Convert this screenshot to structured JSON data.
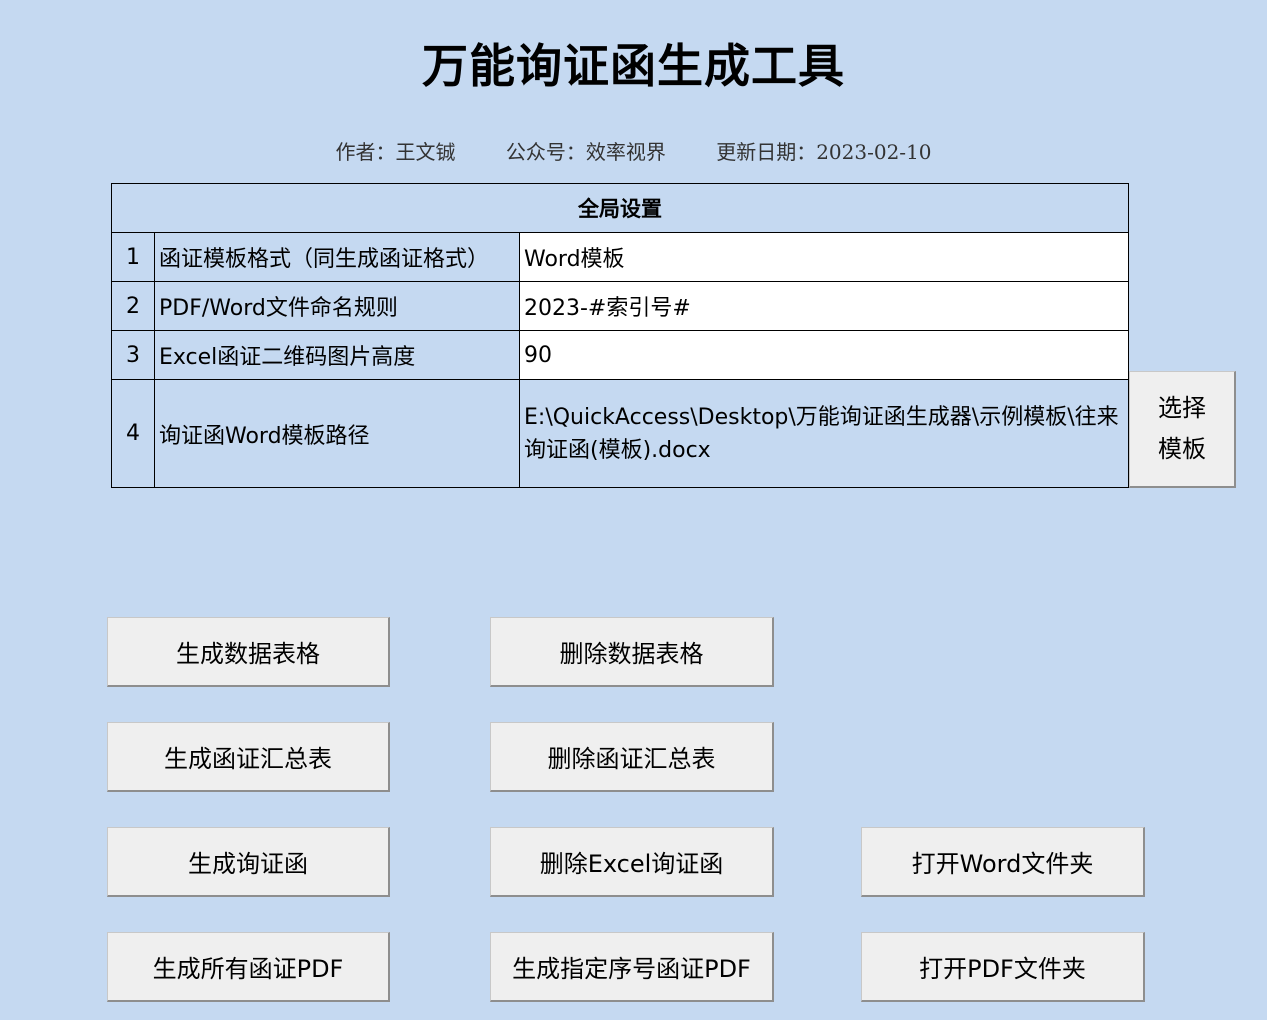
{
  "title": "万能询证函生成工具",
  "author": "作者：王文铖",
  "wechat": "公众号：效率视界",
  "update": "更新日期：2023-02-10",
  "settings": {
    "header": "全局设置",
    "rows": [
      {
        "num": "1",
        "label": "函证模板格式（同生成函证格式）",
        "value": "Word模板"
      },
      {
        "num": "2",
        "label": "PDF/Word文件命名规则",
        "value": "2023-#索引号#"
      },
      {
        "num": "3",
        "label": "Excel函证二维码图片高度",
        "value": "90"
      },
      {
        "num": "4",
        "label": "询证函Word模板路径",
        "value": "E:\\QuickAccess\\Desktop\\万能询证函生成器\\示例模板\\往来询证函(模板).docx"
      }
    ]
  },
  "select_template_line1": "选择",
  "select_template_line2": "模板",
  "buttons": {
    "gen_table": "生成数据表格",
    "del_table": "删除数据表格",
    "gen_summary": "生成函证汇总表",
    "del_summary": "删除函证汇总表",
    "gen_letter": "生成询证函",
    "del_excel_letter": "删除Excel询证函",
    "open_word": "打开Word文件夹",
    "gen_all_pdf": "生成所有函证PDF",
    "gen_seq_pdf": "生成指定序号函证PDF",
    "open_pdf": "打开PDF文件夹"
  }
}
